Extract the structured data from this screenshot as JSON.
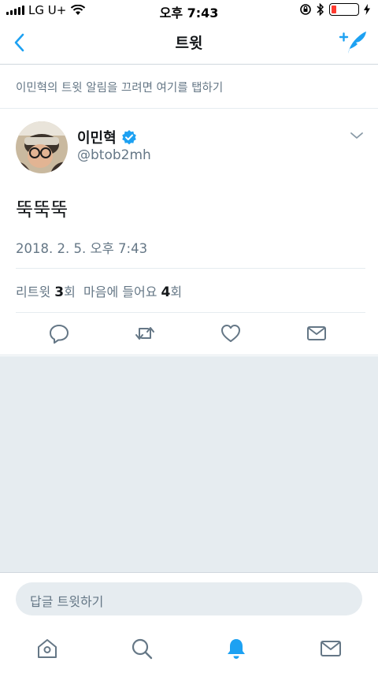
{
  "status_bar": {
    "carrier": "LG U+",
    "time": "오후 7:43",
    "battery_level": 0.1
  },
  "nav": {
    "title": "트윗"
  },
  "notification_hint": "이민혁의 트윗 알림을 끄려면 여기를 탭하기",
  "author": {
    "name": "이민혁",
    "handle": "@btob2mh",
    "verified": true
  },
  "tweet": {
    "text": "뚝뚝뚝",
    "date": "2018. 2. 5. 오후 7:43"
  },
  "stats": {
    "retweet_label": "리트윗",
    "retweet_count": "3",
    "retweet_unit": "회",
    "like_label": "마음에 들어요",
    "like_count": "4",
    "like_unit": "회"
  },
  "reply": {
    "placeholder": "답글 트윗하기"
  },
  "colors": {
    "accent": "#1da1f2",
    "muted": "#657786",
    "divider": "#e6ecf0"
  },
  "icons": {
    "nav": [
      "back-chevron-icon",
      "compose-feather-icon"
    ],
    "actions": [
      "reply-icon",
      "retweet-icon",
      "like-heart-icon",
      "share-envelope-icon"
    ],
    "tabs": [
      "home-icon",
      "search-icon",
      "notifications-bell-icon",
      "messages-icon"
    ]
  }
}
